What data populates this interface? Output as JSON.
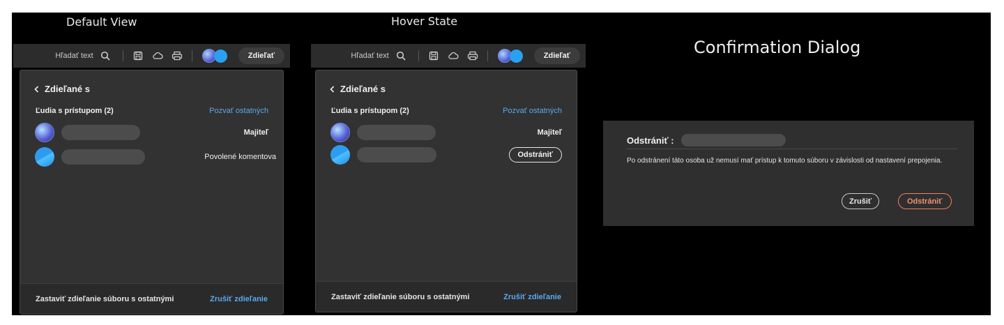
{
  "captions": {
    "default": "Default View",
    "hover": "Hover State",
    "dialog": "Confirmation Dialog"
  },
  "toolbar": {
    "search_label": "Hľadať text",
    "share_label": "Zdieľať",
    "icons": [
      "search-icon",
      "save-icon",
      "cloud-sync-icon",
      "print-icon"
    ]
  },
  "shared_panel": {
    "back_label": "Zdieľané s",
    "people_title": "Ľudia s prístupom (2)",
    "invite_label": "Pozvať ostatných",
    "people": [
      {
        "avatar": "picture-avatar",
        "role": "Majiteľ"
      },
      {
        "avatar": "blue-avatar",
        "role": "Povolené komentova"
      }
    ],
    "remove_label": "Odstrániť",
    "footer_text": "Zastaviť zdieľanie súboru s ostatnými",
    "footer_action": "Zrušiť zdieľanie"
  },
  "dialog": {
    "title": "Odstrániť :",
    "body": "Po odstránení táto osoba už nemusí mať prístup k tomuto súboru v závislosti od nastavení prepojenia.",
    "cancel": "Zrušiť",
    "confirm": "Odstrániť"
  },
  "colors": {
    "background": "#000000",
    "panel": "#323232",
    "link": "#5aa9f0",
    "destructive": "#f09070"
  }
}
